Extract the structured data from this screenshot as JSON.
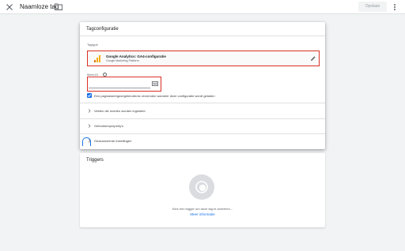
{
  "header": {
    "title": "Naamloze tag",
    "save_label": "Opslaan",
    "close_icon": "close-icon",
    "folder_icon": "folder-icon",
    "more_icon": "more-vert-icon"
  },
  "config": {
    "title": "Tagconfiguratie",
    "tagtype_label": "Tagtype",
    "tagtype_name": "Google Analytics: GA4-configuratie",
    "tagtype_vendor": "Google Marketing Platform",
    "measurement_label": "Meet-ID",
    "measurement_value": "",
    "send_pageview_label": "Een paginaweergavegebeurtenis verzenden wanneer deze configuratie wordt geladen",
    "send_pageview_checked": true,
    "rows": [
      {
        "label": "Velden die moeten worden ingesteld"
      },
      {
        "label": "Gebruikersproperty's"
      },
      {
        "label": "Geavanceerde instellingen"
      }
    ]
  },
  "triggers": {
    "title": "Triggers",
    "empty_text": "Kies een trigger om deze tag te activeren...",
    "learn_more": "Meer informatie"
  },
  "colors": {
    "accent": "#1a73e8",
    "error_outline": "#d93025",
    "ga_orange": "#f9ab00",
    "ga_dark_orange": "#e37400"
  }
}
